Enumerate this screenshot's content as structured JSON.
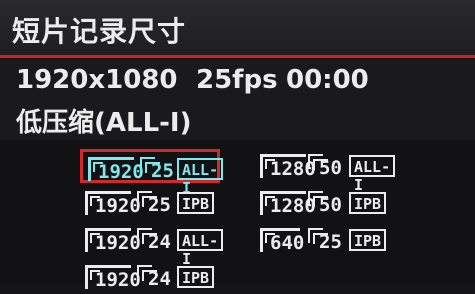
{
  "header": {
    "title": "短片记录尺寸"
  },
  "status": {
    "resolution": "1920x1080",
    "frame_rate": "25fps",
    "time": "00:00",
    "compression": "低压缩(ALL-I)"
  },
  "options": [
    {
      "res": "1920",
      "fps": "25",
      "comp": "ALL-I"
    },
    {
      "res": "1280",
      "fps": "50",
      "comp": "ALL-I"
    },
    {
      "res": "1920",
      "fps": "25",
      "comp": "IPB"
    },
    {
      "res": "1280",
      "fps": "50",
      "comp": "IPB"
    },
    {
      "res": "1920",
      "fps": "24",
      "comp": "ALL-I"
    },
    {
      "res": "640",
      "fps": "25",
      "comp": "IPB"
    },
    {
      "res": "1920",
      "fps": "24",
      "comp": "IPB"
    }
  ],
  "colors": {
    "selection_border": "#d22a2a",
    "selected_icon": "#7fe8ef",
    "title_rule": "#d21f1f"
  }
}
